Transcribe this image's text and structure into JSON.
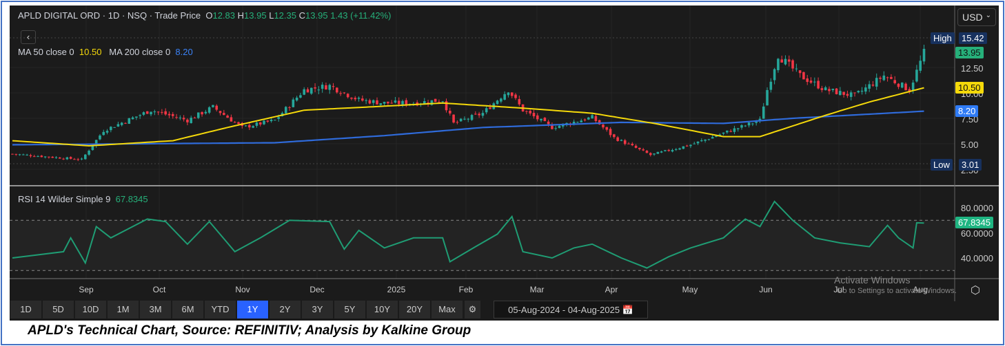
{
  "header": {
    "title": "APLD DIGITAL ORD · 1D · NSQ · Trade Price",
    "o_label": "O",
    "o": "12.83",
    "h_label": "H",
    "h": "13.95",
    "l_label": "L",
    "l": "12.35",
    "c_label": "C",
    "c": "13.95",
    "change": "1.43 (+11.42%)"
  },
  "ma": {
    "ma50_label": "MA 50 close 0",
    "ma50": "10.50",
    "ma200_label": "MA 200 close 0",
    "ma200": "8.20"
  },
  "currency": "USD",
  "price_axis": {
    "ticks": [
      "12.50",
      "10.00",
      "7.50",
      "5.00",
      "2.50"
    ],
    "high_label": "High",
    "high": "15.42",
    "last": "13.95",
    "ma50": "10.50",
    "ma200": "8.20",
    "low_label": "Low",
    "low": "3.01"
  },
  "rsi": {
    "label": "RSI 14 Wilder Simple 9",
    "value": "67.8345",
    "ticks": [
      "80.0000",
      "60.0000",
      "40.0000"
    ]
  },
  "months": [
    "Sep",
    "Oct",
    "Nov",
    "Dec",
    "2025",
    "Feb",
    "Mar",
    "Apr",
    "May",
    "Jun",
    "Jul",
    "Aug"
  ],
  "ranges": [
    "1D",
    "5D",
    "10D",
    "1M",
    "3M",
    "6M",
    "YTD",
    "1Y",
    "2Y",
    "3Y",
    "5Y",
    "10Y",
    "20Y",
    "Max"
  ],
  "active_range": "1Y",
  "date_range": {
    "from": "05-Aug-2024",
    "sep": "-",
    "to": "04-Aug-2025"
  },
  "watermark": {
    "line1": "Activate Windows",
    "line2": "Go to Settings to activate Windows."
  },
  "caption": "APLD's Technical Chart, Source: REFINITIV; Analysis by Kalkine Group",
  "colors": {
    "up": "#26a69a",
    "down": "#f23645",
    "ma50": "#f5d90a",
    "ma200": "#2f6bdb",
    "rsi": "#1f9d74"
  },
  "chart_data": {
    "type": "candlestick",
    "days": 250,
    "close_keypoints": [
      [
        0,
        4.0
      ],
      [
        19,
        3.45
      ],
      [
        25,
        6.3
      ],
      [
        38,
        8.3
      ],
      [
        48,
        7.3
      ],
      [
        55,
        8.6
      ],
      [
        63,
        6.6
      ],
      [
        72,
        7.3
      ],
      [
        80,
        10.3
      ],
      [
        87,
        10.7
      ],
      [
        95,
        9.3
      ],
      [
        102,
        9.0
      ],
      [
        110,
        9.0
      ],
      [
        118,
        9.3
      ],
      [
        121,
        7.0
      ],
      [
        129,
        8.0
      ],
      [
        136,
        10.3
      ],
      [
        140,
        8.3
      ],
      [
        148,
        6.6
      ],
      [
        159,
        7.6
      ],
      [
        165,
        5.6
      ],
      [
        175,
        3.9
      ],
      [
        186,
        4.9
      ],
      [
        197,
        6.3
      ],
      [
        205,
        7.3
      ],
      [
        207,
        10.3
      ],
      [
        210,
        13.7
      ],
      [
        216,
        11.7
      ],
      [
        223,
        10.3
      ],
      [
        231,
        9.7
      ],
      [
        239,
        11.7
      ],
      [
        246,
        10.3
      ],
      [
        250,
        13.95
      ]
    ],
    "ma50_keypoints": [
      [
        0,
        5.3
      ],
      [
        21,
        4.8
      ],
      [
        44,
        5.3
      ],
      [
        59,
        6.6
      ],
      [
        80,
        8.3
      ],
      [
        97,
        8.6
      ],
      [
        118,
        9.0
      ],
      [
        140,
        8.5
      ],
      [
        159,
        8.0
      ],
      [
        176,
        7.0
      ],
      [
        195,
        5.7
      ],
      [
        205,
        5.7
      ],
      [
        223,
        7.8
      ],
      [
        235,
        9.1
      ],
      [
        250,
        10.5
      ]
    ],
    "ma200_keypoints": [
      [
        0,
        4.9
      ],
      [
        72,
        5.1
      ],
      [
        102,
        5.8
      ],
      [
        129,
        6.6
      ],
      [
        167,
        7.1
      ],
      [
        195,
        7.0
      ],
      [
        214,
        7.5
      ],
      [
        250,
        8.2
      ]
    ],
    "rsi_keypoints": [
      [
        0,
        40
      ],
      [
        14,
        45
      ],
      [
        16,
        56
      ],
      [
        20,
        36
      ],
      [
        23,
        65
      ],
      [
        27,
        56
      ],
      [
        37,
        71
      ],
      [
        42,
        69
      ],
      [
        48,
        51
      ],
      [
        54,
        69
      ],
      [
        61,
        45
      ],
      [
        68,
        56
      ],
      [
        76,
        70
      ],
      [
        87,
        69
      ],
      [
        91,
        47
      ],
      [
        95,
        62
      ],
      [
        102,
        48
      ],
      [
        110,
        56
      ],
      [
        118,
        56
      ],
      [
        120,
        37
      ],
      [
        127,
        49
      ],
      [
        133,
        59
      ],
      [
        137,
        73
      ],
      [
        140,
        45
      ],
      [
        148,
        40
      ],
      [
        154,
        48
      ],
      [
        159,
        51
      ],
      [
        167,
        40
      ],
      [
        174,
        32
      ],
      [
        180,
        41
      ],
      [
        186,
        48
      ],
      [
        195,
        56
      ],
      [
        201,
        71
      ],
      [
        205,
        65
      ],
      [
        209,
        85
      ],
      [
        214,
        70
      ],
      [
        220,
        56
      ],
      [
        227,
        52
      ],
      [
        235,
        49
      ],
      [
        240,
        66
      ],
      [
        243,
        56
      ],
      [
        247,
        48
      ],
      [
        248,
        68
      ],
      [
        250,
        67.83
      ]
    ],
    "price_range": [
      2.0,
      16.5
    ],
    "rsi_range": [
      25,
      90
    ],
    "rsi_bands": [
      30,
      70
    ]
  }
}
